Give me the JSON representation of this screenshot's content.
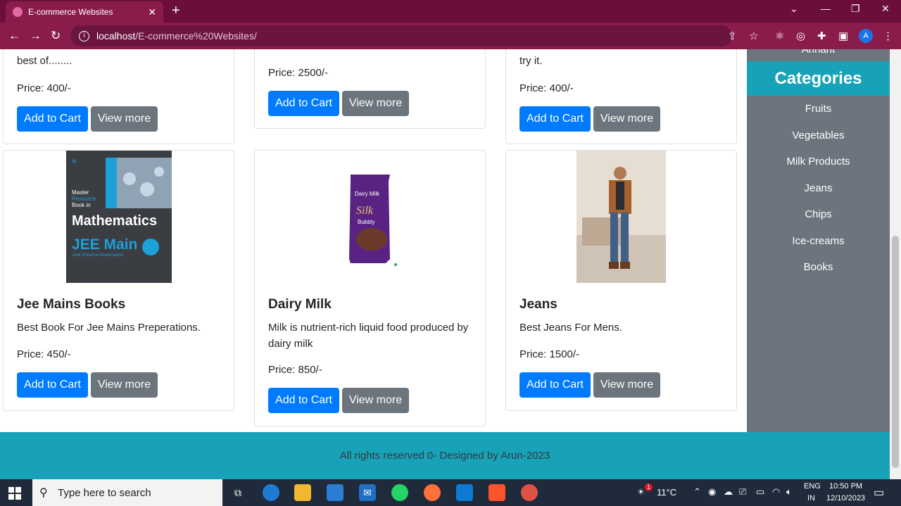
{
  "browser": {
    "tab_title": "E-commerce Websites",
    "tab_close": "✕",
    "new_tab": "+",
    "url_host": "localhost",
    "url_path": "/E-commerce%20Websites/",
    "profile_initial": "A"
  },
  "products": [
    {
      "desc": "best of........",
      "price": "Price: 400/-",
      "add": "Add to Cart",
      "view": "View more"
    },
    {
      "price": "Price: 2500/-",
      "add": "Add to Cart",
      "view": "View more"
    },
    {
      "desc": "try it.",
      "price": "Price: 400/-",
      "add": "Add to Cart",
      "view": "View more"
    },
    {
      "title": "Jee Mains Books",
      "desc": "Best Book For Jee Mains Preperations.",
      "price": "Price: 450/-",
      "add": "Add to Cart",
      "view": "View more",
      "img": {
        "line1": "Master",
        "line2": "Resource",
        "line3": "Book in",
        "big": "Mathematics",
        "exam": "JEE Main",
        "exam_sub": "Joint Entrance Examination"
      }
    },
    {
      "title": "Dairy Milk",
      "desc": "Milk is nutrient-rich liquid food produced by dairy milk",
      "price": "Price: 850/-",
      "add": "Add to Cart",
      "view": "View more",
      "img": {
        "brand": "Dairy Milk",
        "variant": "Silk",
        "sub": "Bubbly"
      }
    },
    {
      "title": "Jeans",
      "desc": "Best Jeans For Mens.",
      "price": "Price: 1500/-",
      "add": "Add to Cart",
      "view": "View more"
    }
  ],
  "sidebar": {
    "top_item": "Arihant",
    "header": "Categories",
    "items": [
      "Fruits",
      "Vegetables",
      "Milk Products",
      "Jeans",
      "Chips",
      "Ice-creams",
      "Books"
    ]
  },
  "footer": {
    "text": "All rights reserved 0- Designed by Arun-2023"
  },
  "taskbar": {
    "search_placeholder": "Type here to search",
    "weather": "11°C",
    "weather_badge": "1",
    "lang1": "ENG",
    "lang2": "IN",
    "time": "10:50 PM",
    "date": "12/10/2023"
  }
}
